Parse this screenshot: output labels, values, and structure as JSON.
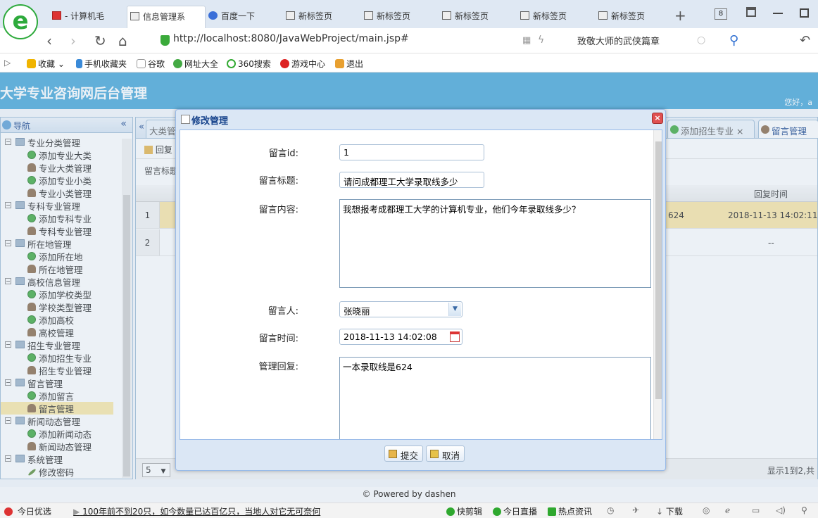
{
  "browser": {
    "tabs": [
      {
        "label": "- 计算机毛"
      },
      {
        "label": "信息管理系"
      },
      {
        "label": "百度一下"
      },
      {
        "label": "新标签页"
      },
      {
        "label": "新标签页"
      },
      {
        "label": "新标签页"
      },
      {
        "label": "新标签页"
      },
      {
        "label": "新标签页"
      }
    ],
    "new_tab": "+",
    "tab_count": "8",
    "url": "http://localhost:8080/JavaWebProject/main.jsp#",
    "search_text": "致敬大师的武侠篇章",
    "bookmarks": [
      "收藏",
      "手机收藏夹",
      "谷歌",
      "网址大全",
      "360搜索",
      "游戏中心",
      "退出"
    ]
  },
  "app": {
    "title": "大学专业咨询网后台管理",
    "greeting": "您好，a",
    "nav_title": "导航",
    "collapse": "«",
    "nav": [
      {
        "label": "专业分类管理",
        "children": [
          "添加专业大类",
          "专业大类管理",
          "添加专业小类",
          "专业小类管理"
        ]
      },
      {
        "label": "专科专业管理",
        "children": [
          "添加专科专业",
          "专科专业管理"
        ]
      },
      {
        "label": "所在地管理",
        "children": [
          "添加所在地",
          "所在地管理"
        ]
      },
      {
        "label": "高校信息管理",
        "children": [
          "添加学校类型",
          "学校类型管理",
          "添加高校",
          "高校管理"
        ]
      },
      {
        "label": "招生专业管理",
        "children": [
          "添加招生专业",
          "招生专业管理"
        ]
      },
      {
        "label": "留言管理",
        "children": [
          "添加留言",
          "留言管理"
        ]
      },
      {
        "label": "新闻动态管理",
        "children": [
          "添加新闻动态",
          "新闻动态管理"
        ]
      },
      {
        "label": "系统管理",
        "children": [
          "修改密码"
        ]
      }
    ],
    "panel_tabs": [
      "大类管",
      "添加招生专业",
      "留言管理"
    ],
    "toolbar_reply": "回复",
    "filter_label": "留言标题",
    "col_reply_time": "回复时间",
    "rows": [
      {
        "num": "1",
        "reply": "624",
        "time": "2018-11-13 14:02:11"
      },
      {
        "num": "2",
        "reply": "",
        "time": "--"
      }
    ],
    "page_size": "5",
    "page_info": "显示1到2,共",
    "footer": "© Powered by dashen"
  },
  "dialog": {
    "title": "修改管理",
    "close": "×",
    "fields": {
      "id_label": "留言id:",
      "id_value": "1",
      "title_label": "留言标题:",
      "title_value": "请问成都理工大学录取线多少",
      "content_label": "留言内容:",
      "content_value": "我想报考成都理工大学的计算机专业，他们今年录取线多少？",
      "author_label": "留言人:",
      "author_value": "张晓丽",
      "time_label": "留言时间:",
      "time_value": "2018-11-13 14:02:08",
      "reply_label": "管理回复:",
      "reply_value": "一本录取线是624"
    },
    "submit": "提交",
    "cancel": "取消"
  },
  "statusbar": {
    "left1": "今日优选",
    "news": "100年前不到20只，如今数量已达百亿只，当地人对它无可奈何",
    "items": [
      "快剪辑",
      "今日直播",
      "热点资讯",
      "下载"
    ]
  },
  "colors": {
    "header_bg": "#47a7d8",
    "selected_row": "#fbe6a5",
    "dialog_border": "#99bbe8"
  }
}
